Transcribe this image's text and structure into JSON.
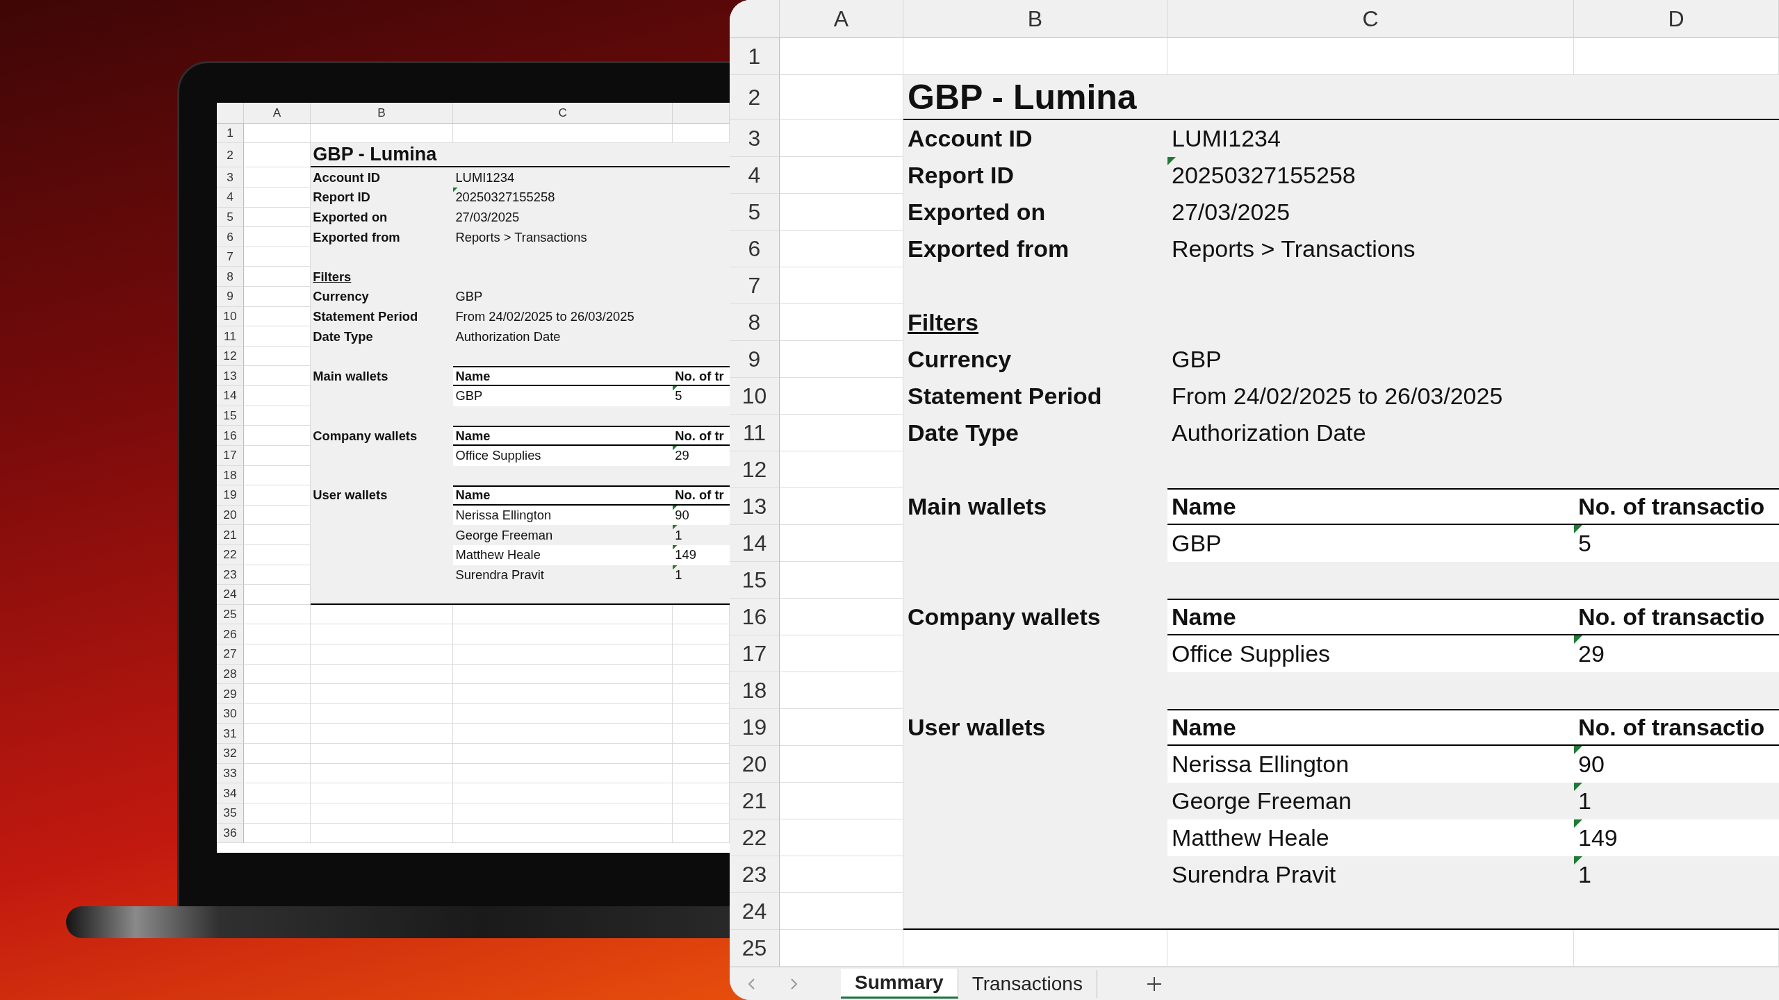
{
  "laptop": {
    "sheet": {
      "columns": [
        "A",
        "B",
        "C"
      ],
      "row_numbers": [
        "1",
        "2",
        "3",
        "4",
        "5",
        "6",
        "7",
        "8",
        "9",
        "10",
        "11",
        "12",
        "13",
        "14",
        "15",
        "16",
        "17",
        "18",
        "19",
        "20",
        "21",
        "22",
        "23",
        "24",
        "25",
        "26",
        "27",
        "28",
        "29",
        "30",
        "31",
        "32",
        "33",
        "34",
        "35",
        "36"
      ],
      "title": "GBP - Lumina",
      "details": [
        {
          "label": "Account ID",
          "value": "LUMI1234",
          "flagged": false
        },
        {
          "label": "Report ID",
          "value": "20250327155258",
          "flagged": true
        },
        {
          "label": "Exported on",
          "value": "27/03/2025",
          "flagged": false
        },
        {
          "label": "Exported from",
          "value": "Reports > Transactions",
          "flagged": false
        }
      ],
      "filters_heading": "Filters",
      "filters": [
        {
          "label": "Currency",
          "value": "GBP",
          "flagged": false
        },
        {
          "label": "Statement Period",
          "value": "From 24/02/2025 to 26/03/2025",
          "flagged": false
        },
        {
          "label": "Date Type",
          "value": "Authorization Date",
          "flagged": false
        }
      ],
      "groups": [
        {
          "label": "Main wallets",
          "headers": [
            "Name",
            "No. of tr"
          ],
          "rows": [
            {
              "name": "GBP",
              "count": "5",
              "flagged": true
            }
          ]
        },
        {
          "label": "Company wallets",
          "headers": [
            "Name",
            "No. of tr"
          ],
          "rows": [
            {
              "name": "Office Supplies",
              "count": "29",
              "flagged": true
            }
          ]
        },
        {
          "label": "User wallets",
          "headers": [
            "Name",
            "No. of tr"
          ],
          "rows": [
            {
              "name": "Nerissa Ellington",
              "count": "90",
              "flagged": true
            },
            {
              "name": "George Freeman",
              "count": "1",
              "flagged": true
            },
            {
              "name": "Matthew Heale",
              "count": "149",
              "flagged": true
            },
            {
              "name": "Surendra Pravit",
              "count": "1",
              "flagged": true
            }
          ]
        }
      ]
    }
  },
  "zoom_panel": {
    "sheet": {
      "columns": [
        "A",
        "B",
        "C",
        "D"
      ],
      "row_numbers": [
        "1",
        "2",
        "3",
        "4",
        "5",
        "6",
        "7",
        "8",
        "9",
        "10",
        "11",
        "12",
        "13",
        "14",
        "15",
        "16",
        "17",
        "18",
        "19",
        "20",
        "21",
        "22",
        "23",
        "24",
        "25"
      ],
      "title": "GBP - Lumina",
      "details": [
        {
          "label": "Account ID",
          "value": "LUMI1234",
          "flagged": false
        },
        {
          "label": "Report ID",
          "value": "20250327155258",
          "flagged": true
        },
        {
          "label": "Exported on",
          "value": "27/03/2025",
          "flagged": false
        },
        {
          "label": "Exported from",
          "value": "Reports > Transactions",
          "flagged": false
        }
      ],
      "filters_heading": "Filters",
      "filters": [
        {
          "label": "Currency",
          "value": "GBP",
          "flagged": false
        },
        {
          "label": "Statement Period",
          "value": "From 24/02/2025 to 26/03/2025",
          "flagged": false
        },
        {
          "label": "Date Type",
          "value": "Authorization Date",
          "flagged": false
        }
      ],
      "groups": [
        {
          "label": "Main wallets",
          "headers": [
            "Name",
            "No. of transactio"
          ],
          "rows": [
            {
              "name": "GBP",
              "count": "5",
              "flagged": true
            }
          ]
        },
        {
          "label": "Company wallets",
          "headers": [
            "Name",
            "No. of transactio"
          ],
          "rows": [
            {
              "name": "Office Supplies",
              "count": "29",
              "flagged": true
            }
          ]
        },
        {
          "label": "User wallets",
          "headers": [
            "Name",
            "No. of transactio"
          ],
          "rows": [
            {
              "name": "Nerissa Ellington",
              "count": "90",
              "flagged": true
            },
            {
              "name": "George Freeman",
              "count": "1",
              "flagged": true
            },
            {
              "name": "Matthew Heale",
              "count": "149",
              "flagged": true
            },
            {
              "name": "Surendra Pravit",
              "count": "1",
              "flagged": true
            }
          ]
        }
      ]
    },
    "tabs": [
      {
        "label": "Summary",
        "selected": true
      },
      {
        "label": "Transactions",
        "selected": false
      }
    ]
  }
}
